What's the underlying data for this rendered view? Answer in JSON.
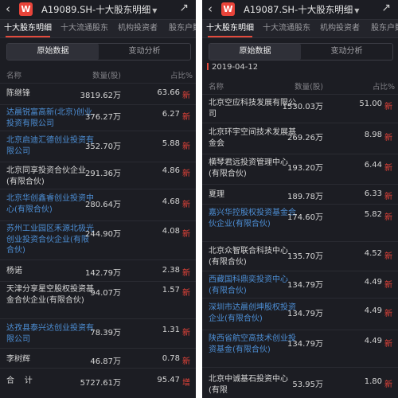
{
  "colors": {
    "background": "#1c1d23",
    "link": "#4d8fd6",
    "accent": "#e9443a"
  },
  "left": {
    "title": "A19089.SH-十大股东明细",
    "logo": "W",
    "tabs": [
      "十大股东明细",
      "十大流通股东",
      "机构投资者",
      "股东户数"
    ],
    "segments": [
      "原始数据",
      "变动分析"
    ],
    "columns": {
      "name": "名称",
      "qty": "数量(股)",
      "pct": "占比%"
    },
    "rows": [
      {
        "name": "陈继锋",
        "qty": "3819.62万",
        "pct": "63.66",
        "tag": "新",
        "link": false
      },
      {
        "name": "达晨锐富高新(北京)创业投资有限公司",
        "qty": "376.27万",
        "pct": "6.27",
        "tag": "新",
        "link": true
      },
      {
        "name": "北京启迪汇德创业投资有限公司",
        "qty": "352.70万",
        "pct": "5.88",
        "tag": "新",
        "link": true
      },
      {
        "name": "北京同享投资合伙企业(有限合伙)",
        "qty": "291.36万",
        "pct": "4.86",
        "tag": "新",
        "link": false
      },
      {
        "name": "北京华创鑫睿创业投资中心(有限合伙)",
        "qty": "280.64万",
        "pct": "4.68",
        "tag": "新",
        "link": true
      },
      {
        "name": "苏州工业园区禾源北极光创业投资合伙企业(有限合伙)",
        "qty": "244.90万",
        "pct": "4.08",
        "tag": "新",
        "link": true
      },
      {
        "name": "杨诺",
        "qty": "142.79万",
        "pct": "2.38",
        "tag": "新",
        "link": false
      },
      {
        "name": "天津分享星空股权投资基金合伙企业(有限合伙)",
        "qty": "94.07万",
        "pct": "1.57",
        "tag": "新",
        "link": false
      },
      {
        "name": "达孜县泰兴达创业投资有限公司",
        "qty": "78.39万",
        "pct": "1.31",
        "tag": "新",
        "link": true
      },
      {
        "name": "李树辉",
        "qty": "46.87万",
        "pct": "0.78",
        "tag": "新",
        "link": false
      },
      {
        "name": "合    计",
        "qty": "5727.61万",
        "pct": "95.47",
        "tag": "增",
        "link": false
      }
    ]
  },
  "right": {
    "title": "A19087.SH-十大股东明细",
    "logo": "W",
    "tabs": [
      "十大股东明细",
      "十大流通股东",
      "机构投资者",
      "股东户数"
    ],
    "segments": [
      "原始数据",
      "变动分析"
    ],
    "date": "2019-04-12",
    "columns": {
      "name": "名称",
      "qty": "数量(股)",
      "pct": "占比%"
    },
    "rows": [
      {
        "name": "北京空应科技发展有限公司",
        "qty": "1530.03万",
        "pct": "51.00",
        "tag": "新",
        "link": false
      },
      {
        "name": "北京环宇空间技术发展基金会",
        "qty": "269.26万",
        "pct": "8.98",
        "tag": "新",
        "link": false
      },
      {
        "name": "横琴君远投资管理中心(有限合伙)",
        "qty": "193.20万",
        "pct": "6.44",
        "tag": "新",
        "link": false
      },
      {
        "name": "夏理",
        "qty": "189.78万",
        "pct": "6.33",
        "tag": "新",
        "link": false
      },
      {
        "name": "嘉兴华控股权投资基金合伙企业(有限合伙)",
        "qty": "174.60万",
        "pct": "5.82",
        "tag": "新",
        "link": true
      },
      {
        "name": "北京众智联合科技中心(有限合伙)",
        "qty": "135.70万",
        "pct": "4.52",
        "tag": "新",
        "link": false
      },
      {
        "name": "西藏国科鼎奕投资中心(有限合伙)",
        "qty": "134.79万",
        "pct": "4.49",
        "tag": "新",
        "link": true
      },
      {
        "name": "深圳市达晨创坤股权投资企业(有限合伙)",
        "qty": "134.79万",
        "pct": "4.49",
        "tag": "新",
        "link": true
      },
      {
        "name": "陕西省航空高技术创业投资基金(有限合伙)",
        "qty": "134.79万",
        "pct": "4.49",
        "tag": "新",
        "link": true
      },
      {
        "name": "北京中诚基石投资中心(有限",
        "qty": "53.95万",
        "pct": "1.80",
        "tag": "新",
        "link": false
      }
    ]
  }
}
